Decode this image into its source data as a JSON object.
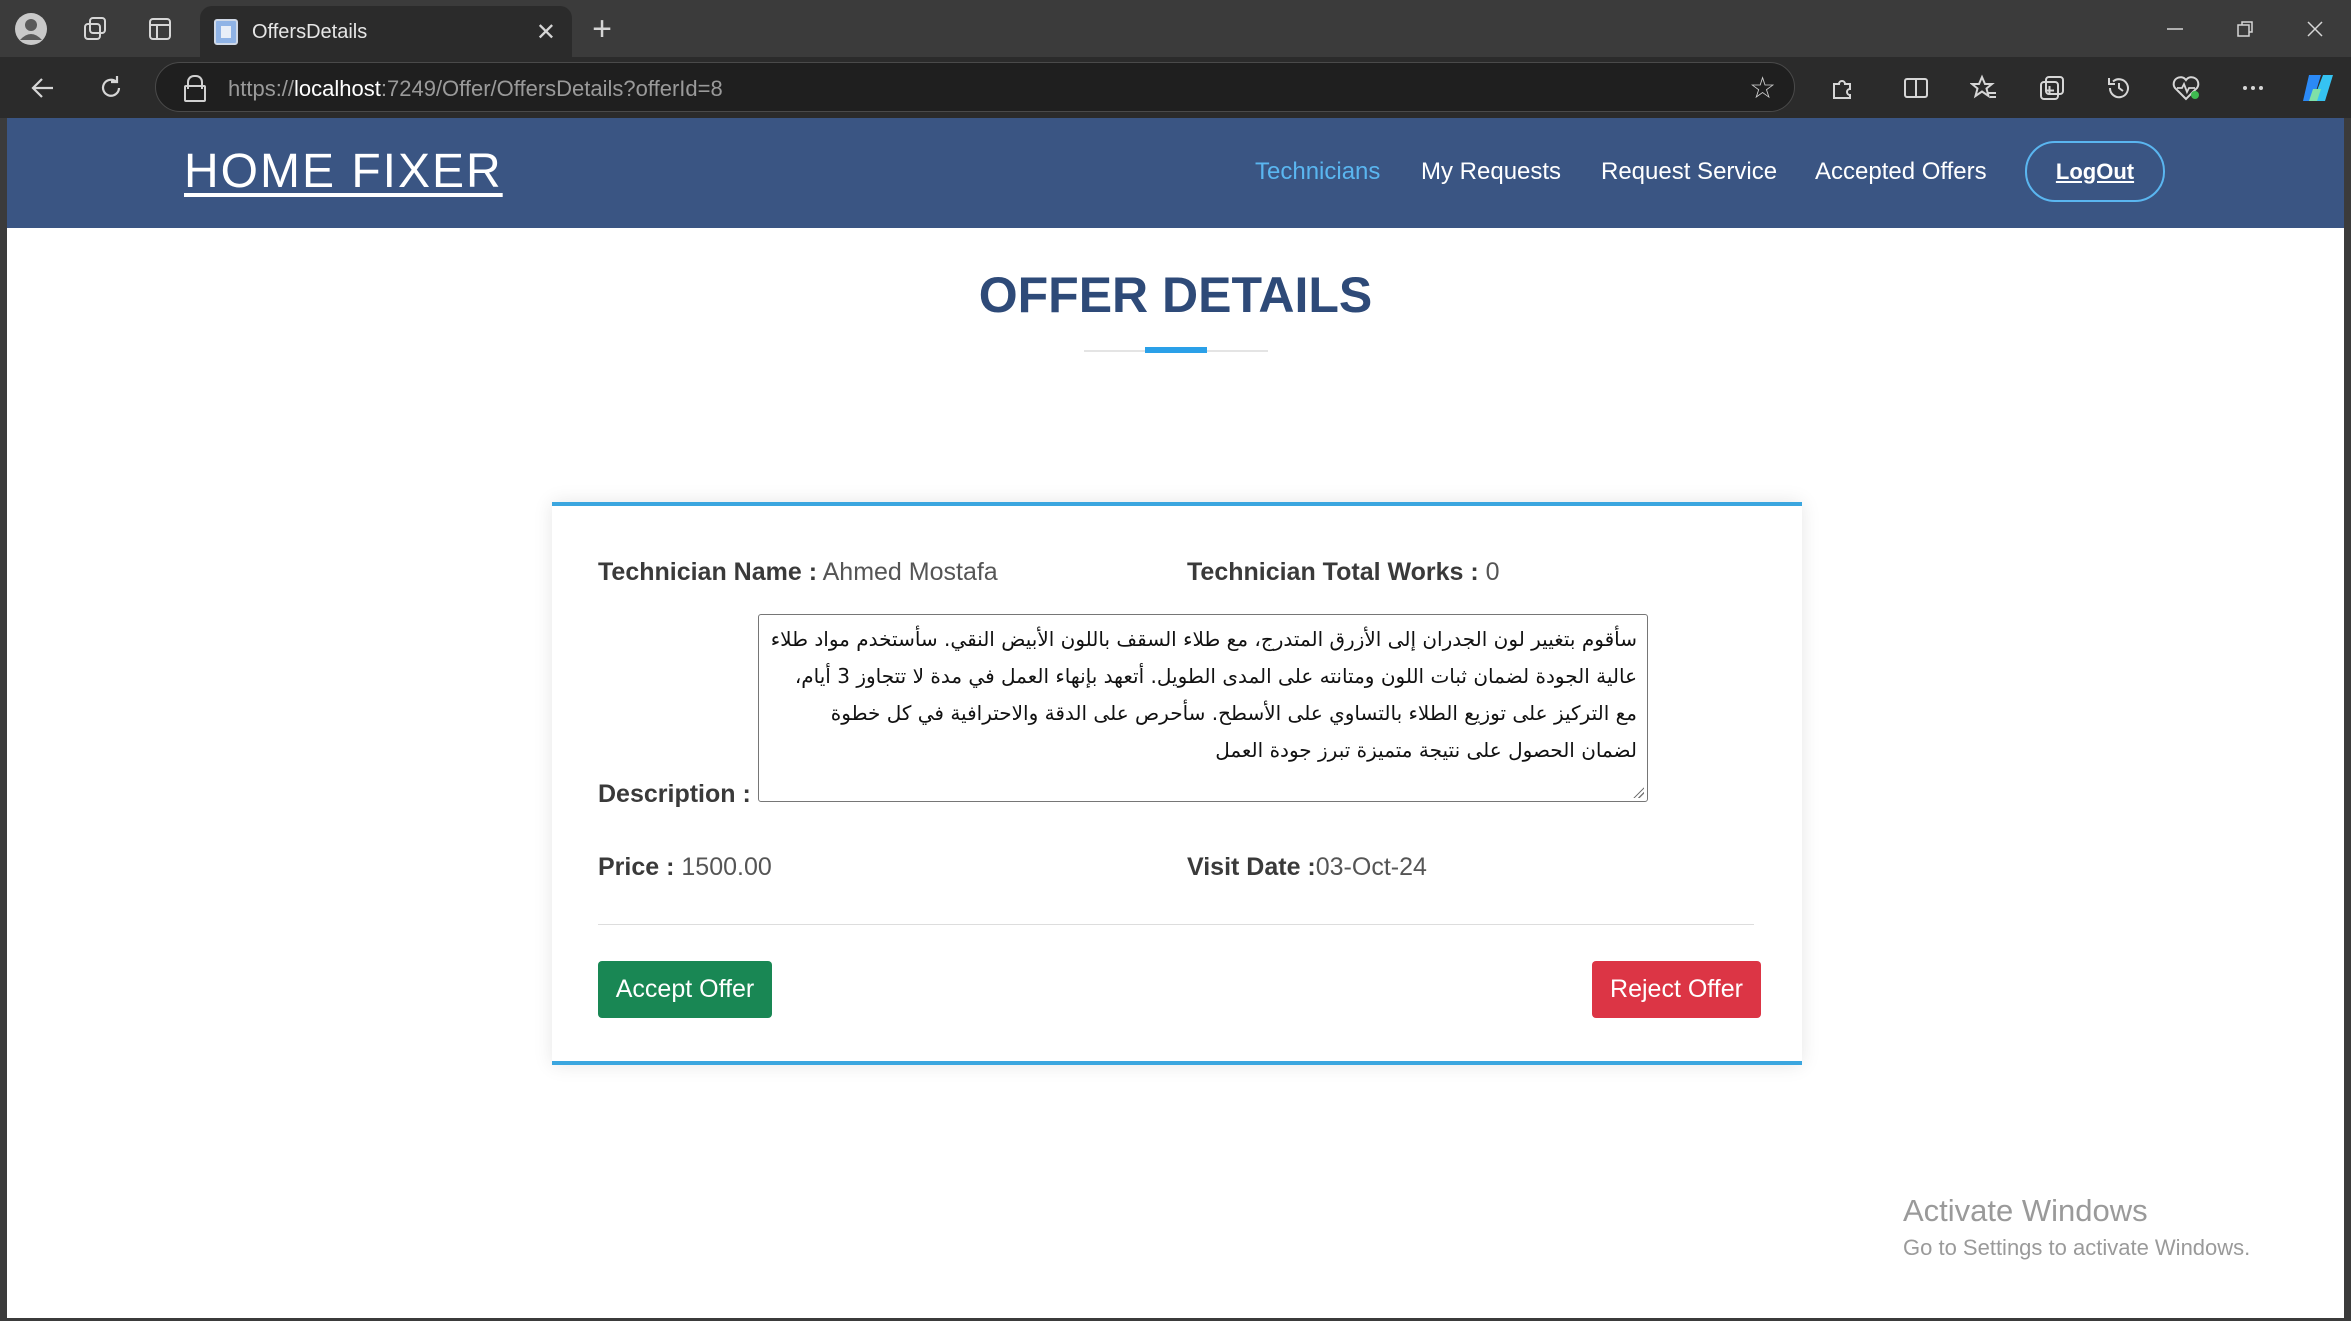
{
  "browser": {
    "tab_title": "OffersDetails",
    "url_scheme": "https://",
    "url_host": "localhost",
    "url_rest": ":7249/Offer/OffersDetails?offerId=8",
    "new_tab_symbol": "+",
    "icons": [
      "profile-icon",
      "workspaces-icon",
      "vertical-tabs-icon",
      "back-icon",
      "refresh-icon",
      "lock-icon",
      "favorite-star-icon",
      "extensions-icon",
      "split-screen-icon",
      "favorites-icon",
      "collections-icon",
      "history-icon",
      "browser-essentials-icon",
      "more-icon",
      "copilot-icon",
      "minimize-icon",
      "restore-icon",
      "close-icon"
    ]
  },
  "navbar": {
    "brand": "HOME FIXER",
    "links": [
      "Technicians",
      "My Requests",
      "Request Service",
      "Accepted Offers"
    ],
    "active_link": "Technicians",
    "logout": "LogOut"
  },
  "page": {
    "title": "OFFER DETAILS"
  },
  "offer": {
    "technician_name_label": "Technician Name :",
    "technician_name": "Ahmed Mostafa",
    "total_works_label": "Technician Total Works :",
    "total_works": "0",
    "description_label": "Description :",
    "description": "سأقوم بتغيير لون الجدران إلى الأزرق المتدرج، مع طلاء السقف باللون الأبيض النقي. سأستخدم مواد طلاء عالية الجودة لضمان ثبات اللون ومتانته على المدى الطويل. أتعهد بإنهاء العمل في مدة لا تتجاوز 3 أيام، مع التركيز على توزيع الطلاء بالتساوي على الأسطح. سأحرص على الدقة والاحترافية في كل خطوة لضمان الحصول على نتيجة متميزة تبرز جودة العمل",
    "price_label": "Price :",
    "price": "1500.00",
    "visit_date_label": "Visit Date :",
    "visit_date": "03-Oct-24",
    "accept_button": "Accept Offer",
    "reject_button": "Reject Offer"
  },
  "colors": {
    "navbar_bg": "#3a5583",
    "active_link": "#5ab6f0",
    "title": "#2e4a78",
    "accent": "#2aa0e8",
    "accept": "#198754",
    "reject": "#dc3545"
  },
  "watermark": {
    "title": "Activate Windows",
    "subtitle": "Go to Settings to activate Windows."
  }
}
